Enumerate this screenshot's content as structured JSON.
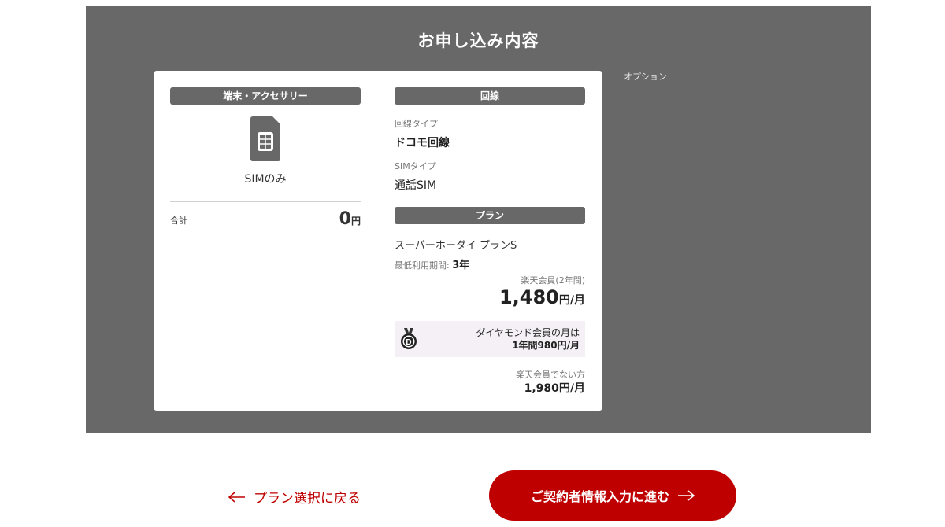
{
  "panel": {
    "title": "お申し込み内容",
    "options_label": "オプション"
  },
  "device": {
    "header": "端末・アクセサリー",
    "icon": "sim-card-icon",
    "name": "SIMのみ",
    "total_label": "合計",
    "total_value": "0",
    "total_unit": "円"
  },
  "line": {
    "header": "回線",
    "line_type_label": "回線タイプ",
    "line_type_value": "ドコモ回線",
    "sim_type_label": "SIMタイプ",
    "sim_type_value": "通話SIM"
  },
  "plan": {
    "header": "プラン",
    "name": "スーパーホーダイ プランS",
    "min_period_label": "最低利用期間: ",
    "min_period_value": "3年",
    "rakuten_label": "楽天会員(2年間)",
    "rakuten_price": "1,480",
    "rakuten_unit": "円/月",
    "diamond_icon": "diamond-member-badge-icon",
    "diamond_line1": "ダイヤモンド会員の月は",
    "diamond_line2": "1年間980円/月",
    "non_member_label": "楽天会員でない方",
    "non_member_price": "1,980円/月"
  },
  "nav": {
    "back_label": "プラン選択に戻る",
    "next_label": "ご契約者情報入力に進む"
  },
  "colors": {
    "panel_bg": "#686868",
    "accent_red": "#bf0000",
    "diamond_bg": "#f4f0f6"
  }
}
